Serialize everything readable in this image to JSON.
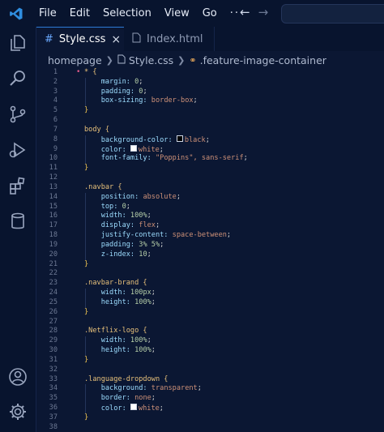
{
  "menu": {
    "file": "File",
    "edit": "Edit",
    "selection": "Selection",
    "view": "View",
    "go": "Go",
    "more": "···"
  },
  "nav": {
    "back": "←",
    "forward": "→"
  },
  "tabs": [
    {
      "label": "Style.css",
      "close": "×"
    },
    {
      "label": "Index.html"
    }
  ],
  "breadcrumb": {
    "folder": "homepage",
    "file": "Style.css",
    "symbol": ".feature-image-container"
  },
  "colors": {
    "swatch_black": "#000000",
    "swatch_white": "#ffffff",
    "accent": "#2d7bd6"
  },
  "code_lines": [
    {
      "n": "1",
      "gutter": "•",
      "segments": [
        {
          "t": "* {",
          "c": "sel"
        }
      ]
    },
    {
      "n": "2",
      "segments": [
        {
          "t": "    margin: ",
          "c": "prop"
        },
        {
          "t": "0",
          "c": "num"
        },
        {
          "t": ";",
          "c": "punc"
        }
      ]
    },
    {
      "n": "3",
      "segments": [
        {
          "t": "    padding: ",
          "c": "prop"
        },
        {
          "t": "0",
          "c": "num"
        },
        {
          "t": ";",
          "c": "punc"
        }
      ]
    },
    {
      "n": "4",
      "segments": [
        {
          "t": "    box-sizing: ",
          "c": "prop"
        },
        {
          "t": "border-box",
          "c": "val"
        },
        {
          "t": ";",
          "c": "punc"
        }
      ]
    },
    {
      "n": "5",
      "segments": [
        {
          "t": "}",
          "c": "brace"
        }
      ]
    },
    {
      "n": "6",
      "segments": []
    },
    {
      "n": "7",
      "segments": [
        {
          "t": "body {",
          "c": "sel"
        }
      ]
    },
    {
      "n": "8",
      "segments": [
        {
          "t": "    background-color: ",
          "c": "prop"
        },
        {
          "swatch": "black"
        },
        {
          "t": "black",
          "c": "val"
        },
        {
          "t": ";",
          "c": "punc"
        }
      ]
    },
    {
      "n": "9",
      "segments": [
        {
          "t": "    color: ",
          "c": "prop"
        },
        {
          "swatch": "white"
        },
        {
          "t": "white",
          "c": "val"
        },
        {
          "t": ";",
          "c": "punc"
        }
      ]
    },
    {
      "n": "10",
      "segments": [
        {
          "t": "    font-family: ",
          "c": "prop"
        },
        {
          "t": "\"Poppins\", sans-serif",
          "c": "val"
        },
        {
          "t": ";",
          "c": "punc"
        }
      ]
    },
    {
      "n": "11",
      "segments": [
        {
          "t": "}",
          "c": "brace"
        }
      ]
    },
    {
      "n": "12",
      "segments": []
    },
    {
      "n": "13",
      "segments": [
        {
          "t": ".navbar {",
          "c": "sel"
        }
      ]
    },
    {
      "n": "14",
      "segments": [
        {
          "t": "    position: ",
          "c": "prop"
        },
        {
          "t": "absolute",
          "c": "val"
        },
        {
          "t": ";",
          "c": "punc"
        }
      ]
    },
    {
      "n": "15",
      "segments": [
        {
          "t": "    top: ",
          "c": "prop"
        },
        {
          "t": "0",
          "c": "num"
        },
        {
          "t": ";",
          "c": "punc"
        }
      ]
    },
    {
      "n": "16",
      "segments": [
        {
          "t": "    width: ",
          "c": "prop"
        },
        {
          "t": "100%",
          "c": "num"
        },
        {
          "t": ";",
          "c": "punc"
        }
      ]
    },
    {
      "n": "17",
      "segments": [
        {
          "t": "    display: ",
          "c": "prop"
        },
        {
          "t": "flex",
          "c": "val"
        },
        {
          "t": ";",
          "c": "punc"
        }
      ]
    },
    {
      "n": "18",
      "segments": [
        {
          "t": "    justify-content: ",
          "c": "prop"
        },
        {
          "t": "space-between",
          "c": "val"
        },
        {
          "t": ";",
          "c": "punc"
        }
      ]
    },
    {
      "n": "19",
      "segments": [
        {
          "t": "    padding: ",
          "c": "prop"
        },
        {
          "t": "3% 5%",
          "c": "num"
        },
        {
          "t": ";",
          "c": "punc"
        }
      ]
    },
    {
      "n": "20",
      "segments": [
        {
          "t": "    z-index: ",
          "c": "prop"
        },
        {
          "t": "10",
          "c": "num"
        },
        {
          "t": ";",
          "c": "punc"
        }
      ]
    },
    {
      "n": "21",
      "segments": [
        {
          "t": "}",
          "c": "brace"
        }
      ]
    },
    {
      "n": "22",
      "segments": []
    },
    {
      "n": "23",
      "segments": [
        {
          "t": ".navbar-brand {",
          "c": "sel"
        }
      ]
    },
    {
      "n": "24",
      "segments": [
        {
          "t": "    width: ",
          "c": "prop"
        },
        {
          "t": "100px",
          "c": "num"
        },
        {
          "t": ";",
          "c": "punc"
        }
      ]
    },
    {
      "n": "25",
      "segments": [
        {
          "t": "    height: ",
          "c": "prop"
        },
        {
          "t": "100%",
          "c": "num"
        },
        {
          "t": ";",
          "c": "punc"
        }
      ]
    },
    {
      "n": "26",
      "segments": [
        {
          "t": "}",
          "c": "brace"
        }
      ]
    },
    {
      "n": "27",
      "segments": []
    },
    {
      "n": "28",
      "segments": [
        {
          "t": ".Netflix-logo {",
          "c": "sel"
        }
      ]
    },
    {
      "n": "29",
      "segments": [
        {
          "t": "    width: ",
          "c": "prop"
        },
        {
          "t": "100%",
          "c": "num"
        },
        {
          "t": ";",
          "c": "punc"
        }
      ]
    },
    {
      "n": "30",
      "segments": [
        {
          "t": "    height: ",
          "c": "prop"
        },
        {
          "t": "100%",
          "c": "num"
        },
        {
          "t": ";",
          "c": "punc"
        }
      ]
    },
    {
      "n": "31",
      "segments": [
        {
          "t": "}",
          "c": "brace"
        }
      ]
    },
    {
      "n": "32",
      "segments": []
    },
    {
      "n": "33",
      "segments": [
        {
          "t": ".language-dropdown {",
          "c": "sel"
        }
      ]
    },
    {
      "n": "34",
      "segments": [
        {
          "t": "    background: ",
          "c": "prop"
        },
        {
          "t": "transparent",
          "c": "val"
        },
        {
          "t": ";",
          "c": "punc"
        }
      ]
    },
    {
      "n": "35",
      "segments": [
        {
          "t": "    border: ",
          "c": "prop"
        },
        {
          "t": "none",
          "c": "val"
        },
        {
          "t": ";",
          "c": "punc"
        }
      ]
    },
    {
      "n": "36",
      "segments": [
        {
          "t": "    color: ",
          "c": "prop"
        },
        {
          "swatch": "white"
        },
        {
          "t": "white",
          "c": "val"
        },
        {
          "t": ";",
          "c": "punc"
        }
      ]
    },
    {
      "n": "37",
      "segments": [
        {
          "t": "}",
          "c": "brace"
        }
      ]
    },
    {
      "n": "38",
      "segments": []
    }
  ]
}
